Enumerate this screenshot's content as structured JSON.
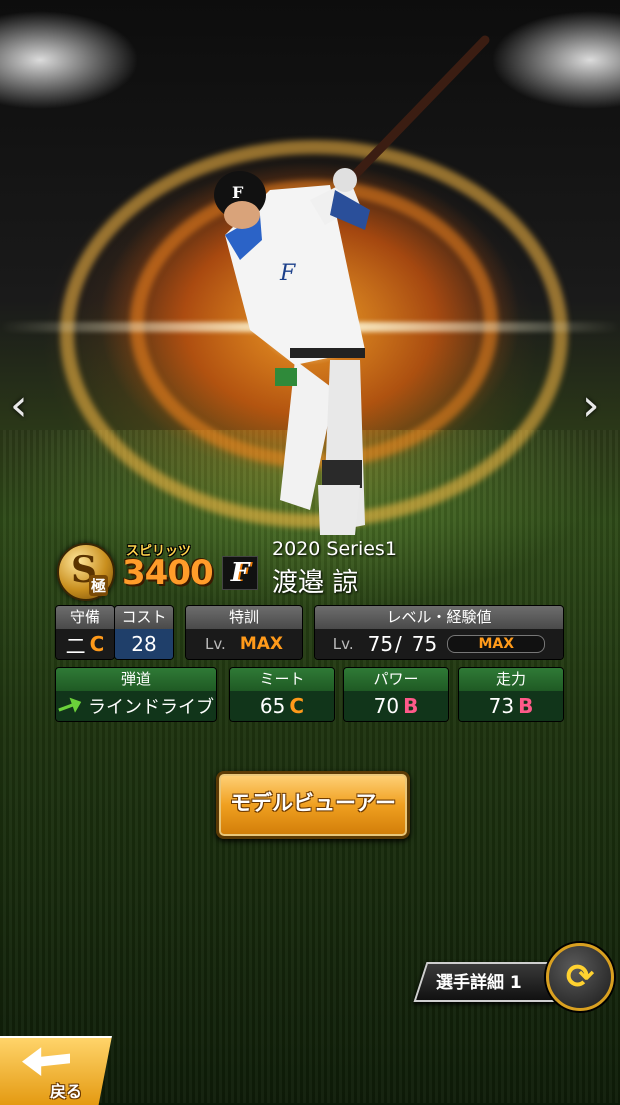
{
  "card": {
    "rank_letter": "S",
    "rank_sub": "極",
    "spirits_label": "スピリッツ",
    "spirits_value": "3400",
    "team_logo_letter": "F",
    "series": "2020 Series1",
    "player_name": "渡邉 諒"
  },
  "stats": {
    "position": {
      "label": "守備",
      "value": "二",
      "grade": "C"
    },
    "cost": {
      "label": "コスト",
      "value": "28"
    },
    "training": {
      "label": "特訓",
      "lv": "Lv.",
      "value": "MAX"
    },
    "level": {
      "label": "レベル・経験値",
      "lv": "Lv.",
      "current": "75",
      "max": "75",
      "gauge": "MAX"
    },
    "trajectory": {
      "label": "弾道",
      "value": "ラインドライブ"
    },
    "meet": {
      "label": "ミート",
      "value": "65",
      "grade": "C"
    },
    "power": {
      "label": "パワー",
      "value": "70",
      "grade": "B"
    },
    "speed": {
      "label": "走力",
      "value": "73",
      "grade": "B"
    }
  },
  "buttons": {
    "model_viewer": "モデルビューアー",
    "player_detail": "選手詳細 1",
    "back": "戻る",
    "prev": "‹",
    "next": "›",
    "refresh": "⟳"
  },
  "icons": {
    "prev": "chevron-left-icon",
    "next": "chevron-right-icon",
    "refresh": "refresh-icon",
    "back": "back-arrow-icon",
    "trajectory": "arrow-up-right-icon"
  },
  "colors": {
    "grade_c": "#ff9a1a",
    "grade_b": "#ff5a8a",
    "button_gold": "#f0a020",
    "stat_green": "#1f5a24"
  }
}
